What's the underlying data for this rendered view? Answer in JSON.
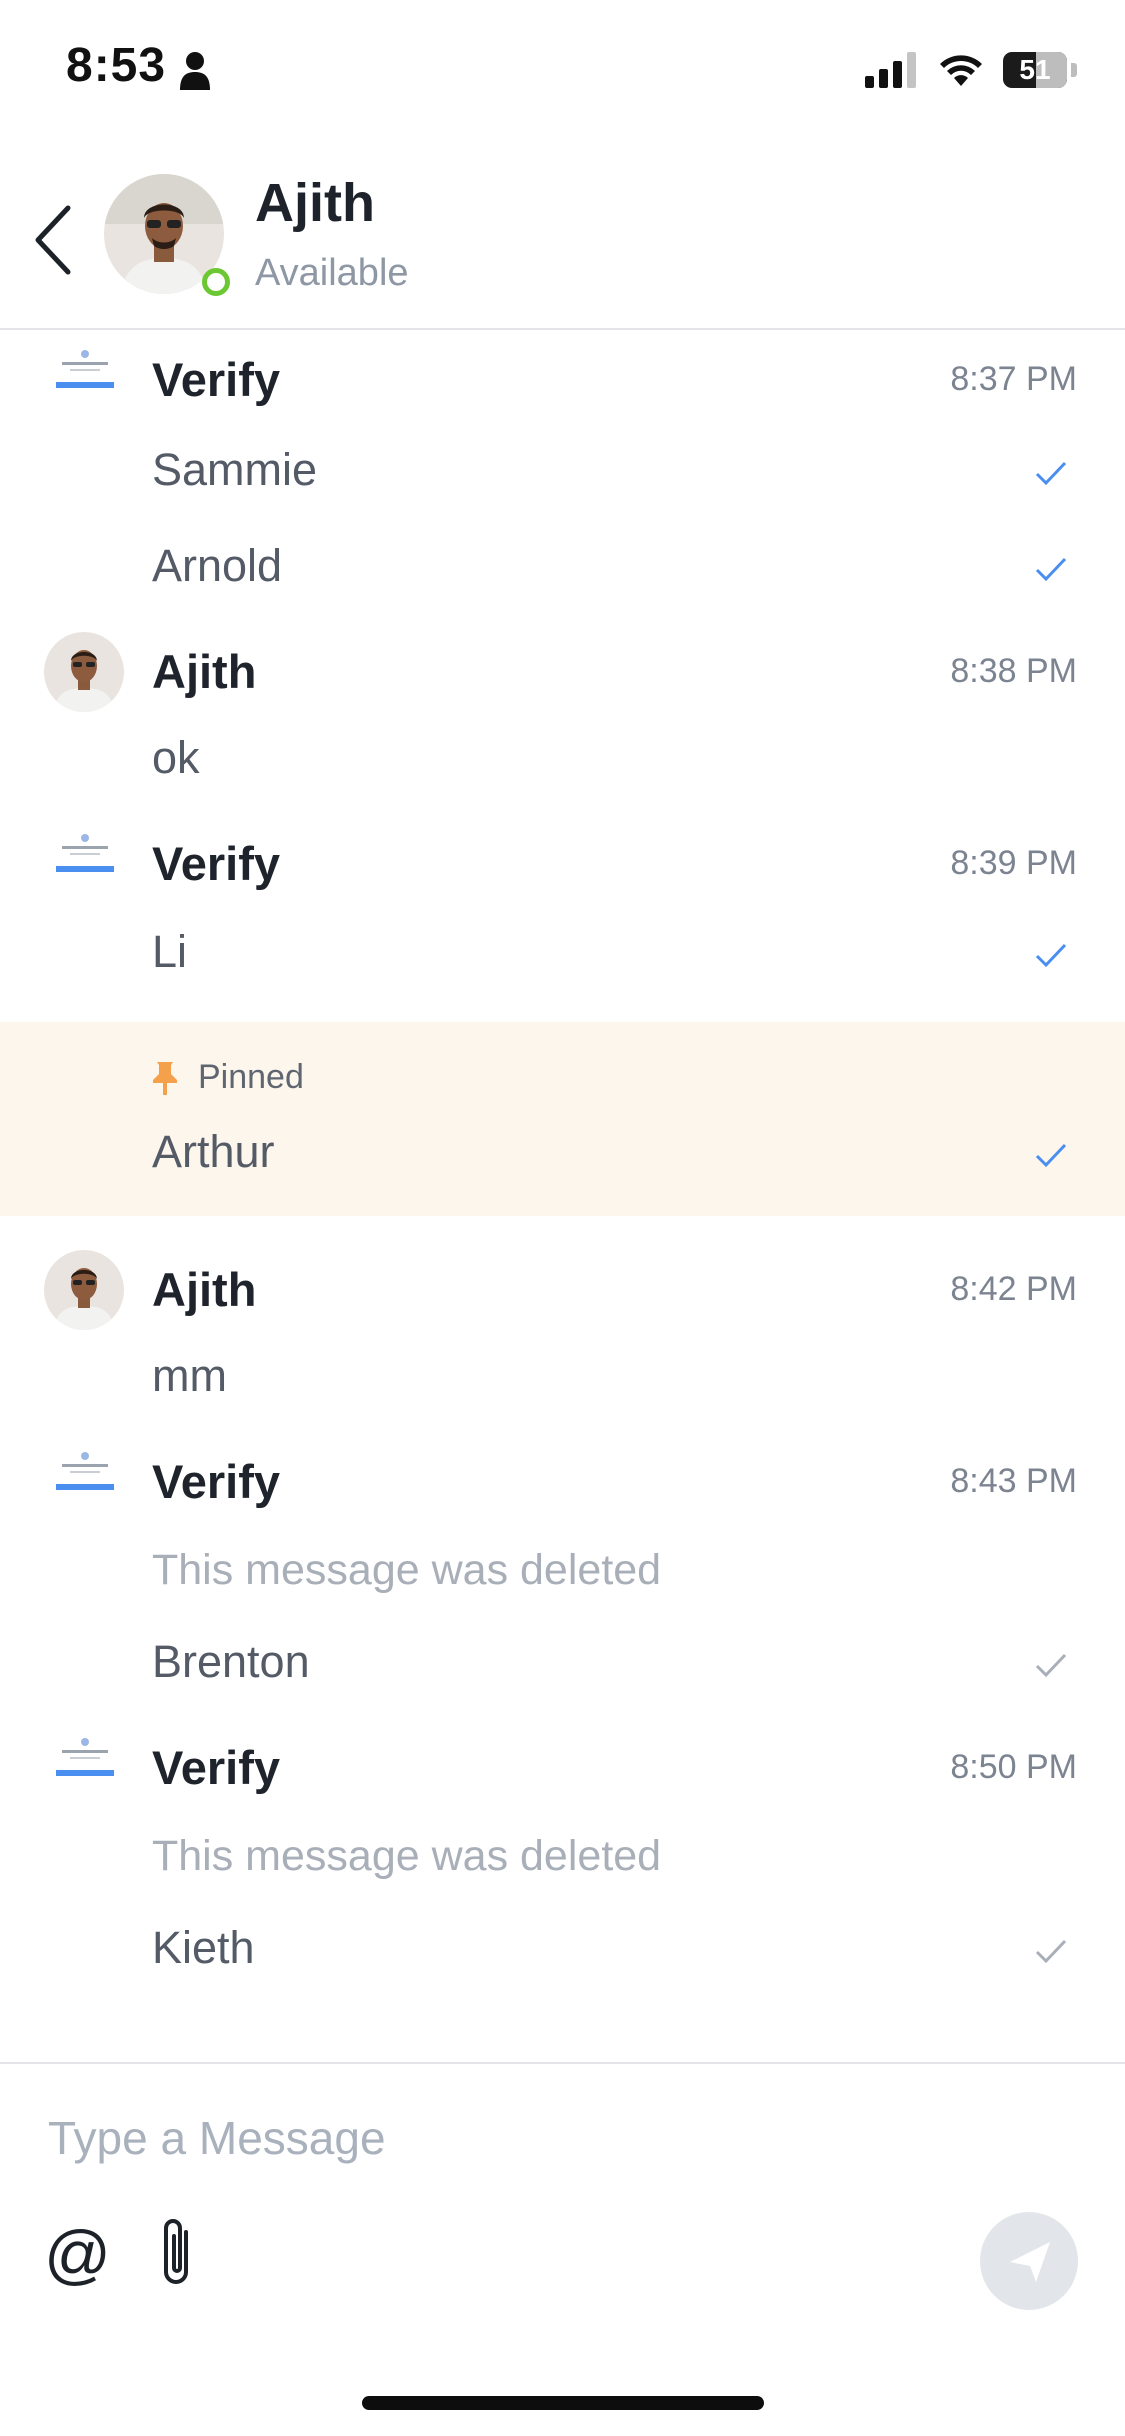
{
  "status_bar": {
    "time": "8:53",
    "battery": "51"
  },
  "header": {
    "contact_name": "Ajith",
    "contact_status": "Available"
  },
  "colors": {
    "accent": "#4a8ef0",
    "presence": "#6cc832",
    "pinned_background": "#fdf6ec",
    "pin": "#f5a14c"
  },
  "messages": [
    {
      "sender": "Verify",
      "time": "8:37 PM",
      "lines": [
        {
          "text": "Sammie",
          "status": "read"
        },
        {
          "text": "Arnold",
          "status": "read"
        }
      ]
    },
    {
      "sender": "Ajith",
      "time": "8:38 PM",
      "lines": [
        {
          "text": "ok"
        }
      ]
    },
    {
      "sender": "Verify",
      "time": "8:39 PM",
      "lines": [
        {
          "text": "Li",
          "status": "read"
        }
      ]
    },
    {
      "pinned_label": "Pinned",
      "lines": [
        {
          "text": "Arthur",
          "status": "read"
        }
      ]
    },
    {
      "sender": "Ajith",
      "time": "8:42 PM",
      "lines": [
        {
          "text": "mm"
        }
      ]
    },
    {
      "sender": "Verify",
      "time": "8:43 PM",
      "lines": [
        {
          "text": "This message was deleted",
          "deleted": true
        },
        {
          "text": "Brenton",
          "status": "sent"
        }
      ]
    },
    {
      "sender": "Verify",
      "time": "8:50 PM",
      "lines": [
        {
          "text": "This message was deleted",
          "deleted": true
        },
        {
          "text": "Kieth",
          "status": "sent"
        }
      ]
    }
  ],
  "composer": {
    "placeholder": "Type a Message",
    "mention_symbol": "@"
  }
}
